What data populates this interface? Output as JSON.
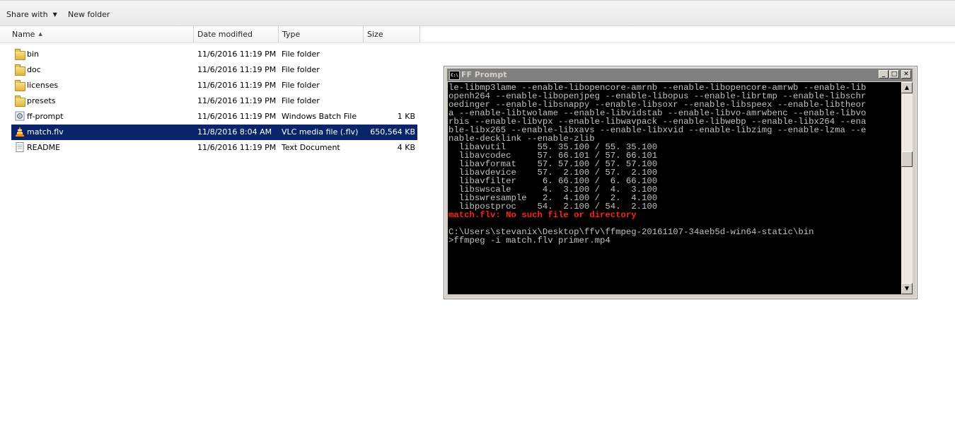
{
  "toolbar": {
    "share_label": "Share with",
    "new_folder_label": "New folder"
  },
  "columns": {
    "name": "Name",
    "date": "Date modified",
    "type": "Type",
    "size": "Size"
  },
  "files": [
    {
      "name": "bin",
      "date": "11/6/2016 11:19 PM",
      "type": "File folder",
      "size": "",
      "icon": "folder-icon"
    },
    {
      "name": "doc",
      "date": "11/6/2016 11:19 PM",
      "type": "File folder",
      "size": "",
      "icon": "folder-icon"
    },
    {
      "name": "licenses",
      "date": "11/6/2016 11:19 PM",
      "type": "File folder",
      "size": "",
      "icon": "folder-icon"
    },
    {
      "name": "presets",
      "date": "11/6/2016 11:19 PM",
      "type": "File folder",
      "size": "",
      "icon": "folder-icon"
    },
    {
      "name": "ff-prompt",
      "date": "11/6/2016 11:19 PM",
      "type": "Windows Batch File",
      "size": "1 KB",
      "icon": "batch-file-icon"
    },
    {
      "name": "match.flv",
      "date": "11/8/2016 8:04 AM",
      "type": "VLC media file (.flv)",
      "size": "650,564 KB",
      "icon": "vlc-cone-icon",
      "selected": true
    },
    {
      "name": "README",
      "date": "11/6/2016 11:19 PM",
      "type": "Text Document",
      "size": "4 KB",
      "icon": "text-document-icon"
    }
  ],
  "cmd": {
    "title": "FF Prompt",
    "icon_text": "C:\\",
    "lines": [
      "le-libmp3lame --enable-libopencore-amrnb --enable-libopencore-amrwb --enable-lib",
      "openh264 --enable-libopenjpeg --enable-libopus --enable-librtmp --enable-libschr",
      "oedinger --enable-libsnappy --enable-libsoxr --enable-libspeex --enable-libtheor",
      "a --enable-libtwolame --enable-libvidstab --enable-libvo-amrwbenc --enable-libvo",
      "rbis --enable-libvpx --enable-libwavpack --enable-libwebp --enable-libx264 --ena",
      "ble-libx265 --enable-libxavs --enable-libxvid --enable-libzimg --enable-lzma --e",
      "nable-decklink --enable-zlib",
      "  libavutil      55. 35.100 / 55. 35.100",
      "  libavcodec     57. 66.101 / 57. 66.101",
      "  libavformat    57. 57.100 / 57. 57.100",
      "  libavdevice    57.  2.100 / 57.  2.100",
      "  libavfilter     6. 66.100 /  6. 66.100",
      "  libswscale      4.  3.100 /  4.  3.100",
      "  libswresample   2.  4.100 /  2.  4.100",
      "  libpostproc    54.  2.100 / 54.  2.100"
    ],
    "error": "match.flv: No such file or directory",
    "prompt_path": "C:\\Users\\stevanix\\Desktop\\ffv\\ffmpeg-20161107-34aeb5d-win64-static\\bin",
    "command": ">ffmpeg -i match.flv primer.mp4"
  }
}
